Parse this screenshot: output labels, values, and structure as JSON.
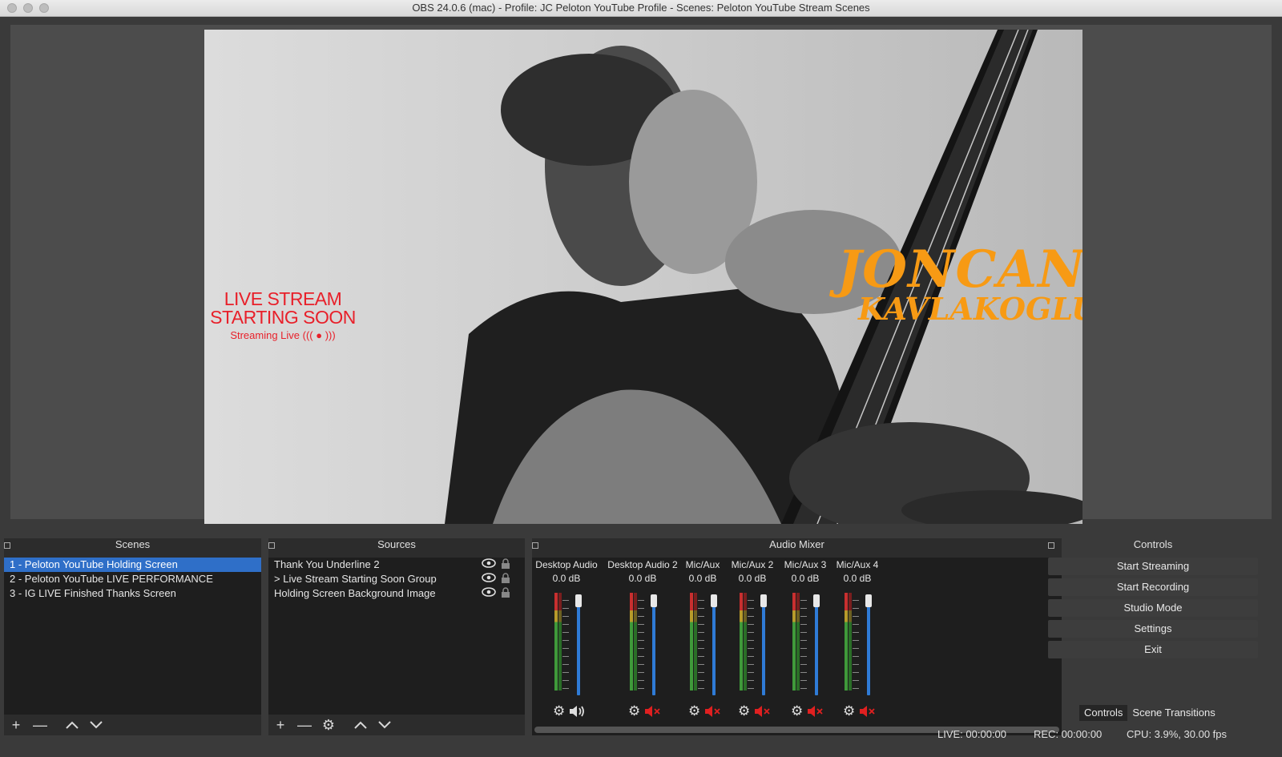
{
  "window": {
    "title": "OBS 24.0.6 (mac) - Profile: JC Peloton YouTube Profile - Scenes: Peloton YouTube Stream Scenes"
  },
  "preview": {
    "overlay_line1": "LIVE STREAM",
    "overlay_line2": "STARTING SOON",
    "overlay_line3": "Streaming Live ((( ● )))",
    "brand_line1": "JONCAN",
    "brand_line2": "KAVLAKOGLU"
  },
  "scenes": {
    "header": "Scenes",
    "items": [
      {
        "label": "1 - Peloton YouTube Holding Screen"
      },
      {
        "label": "2 - Peloton YouTube LIVE PERFORMANCE"
      },
      {
        "label": "3 - IG LIVE Finished Thanks Screen"
      }
    ],
    "selected_index": 0
  },
  "sources": {
    "header": "Sources",
    "items": [
      {
        "label": "Thank You Underline 2"
      },
      {
        "label": "Live Stream Starting Soon Group",
        "expander": ">"
      },
      {
        "label": "Holding Screen Background Image"
      }
    ]
  },
  "mixer": {
    "header": "Audio Mixer",
    "channels": [
      {
        "name": "Desktop Audio",
        "db": "0.0 dB",
        "muted": false
      },
      {
        "name": "Desktop Audio 2",
        "db": "0.0 dB",
        "muted": true
      },
      {
        "name": "Mic/Aux",
        "db": "0.0 dB",
        "muted": true
      },
      {
        "name": "Mic/Aux 2",
        "db": "0.0 dB",
        "muted": true
      },
      {
        "name": "Mic/Aux 3",
        "db": "0.0 dB",
        "muted": true
      },
      {
        "name": "Mic/Aux 4",
        "db": "0.0 dB",
        "muted": true
      }
    ]
  },
  "controls": {
    "header": "Controls",
    "buttons": [
      {
        "label": "Start Streaming"
      },
      {
        "label": "Start Recording"
      },
      {
        "label": "Studio Mode"
      },
      {
        "label": "Settings"
      },
      {
        "label": "Exit"
      }
    ]
  },
  "dock_tabs": [
    {
      "label": "Controls"
    },
    {
      "label": "Scene Transitions"
    }
  ],
  "status": {
    "live": "LIVE: 00:00:00",
    "rec": "REC: 00:00:00",
    "cpu": "CPU: 3.9%, 30.00 fps"
  },
  "colors": {
    "selection": "#2f6fc8",
    "brand": "#f79a14",
    "overlay_red": "#e8202a",
    "mute_red": "#e02020",
    "fader_blue": "#2f7bd6"
  }
}
